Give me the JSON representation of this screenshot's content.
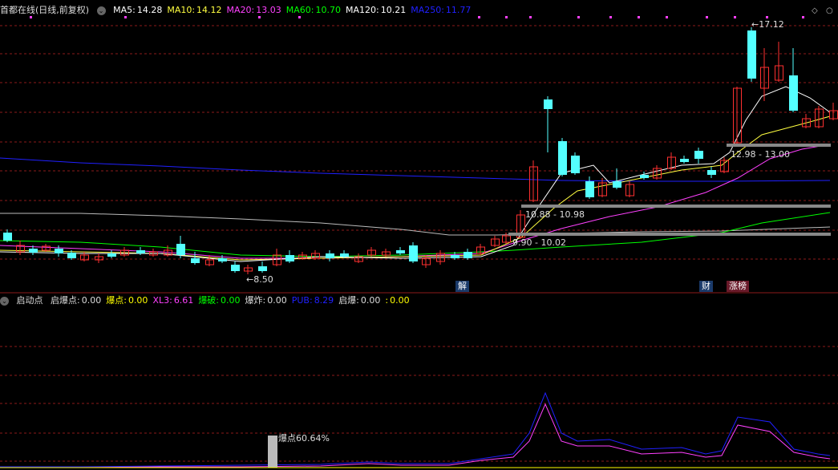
{
  "header": {
    "stock_name": "首都在线",
    "mode": "(日线,前复权)",
    "ma": [
      {
        "label": "MA5:",
        "value": "14.28",
        "color": "#ffffff"
      },
      {
        "label": "MA10:",
        "value": "14.12",
        "color": "#ffff40"
      },
      {
        "label": "MA20:",
        "value": "13.03",
        "color": "#ff40ff"
      },
      {
        "label": "MA60:",
        "value": "10.70",
        "color": "#00ff00"
      },
      {
        "label": "MA120:",
        "value": "10.21",
        "color": "#ffffff"
      },
      {
        "label": "MA250:",
        "value": "11.77",
        "color": "#2020ff"
      }
    ]
  },
  "price_annotations": {
    "high": "17.12",
    "low": "8.50",
    "zone1": "12.98 - 13.00",
    "zone2": "10.88 - 10.98",
    "zone3": "9.90 - 10.02"
  },
  "event_tags": {
    "jie": "解",
    "cai": "财",
    "zhangbang": "涨榜"
  },
  "indicator": {
    "name": "启动点",
    "items": [
      {
        "label": "启爆点:",
        "value": "0.00",
        "color": "#dddddd"
      },
      {
        "label": "爆点:",
        "value": "0.00",
        "color": "#ffff00"
      },
      {
        "label": "XL3:",
        "value": "6.61",
        "color": "#ff40ff"
      },
      {
        "label": "爆破:",
        "value": "0.00",
        "color": "#00ff00"
      },
      {
        "label": "爆炸:",
        "value": "0.00",
        "color": "#dddddd"
      },
      {
        "label": "PUB:",
        "value": "8.29",
        "color": "#2020ff"
      },
      {
        "label": "启爆:",
        "value": "0.00",
        "color": "#dddddd"
      },
      {
        "label": ":",
        "value": "0.00",
        "color": "#ffff00"
      }
    ],
    "bar_label": "爆点60.64%"
  },
  "colors": {
    "up": "#ff3030",
    "down": "#54ffff",
    "grid": "#8b1a1a",
    "bg": "#000000"
  },
  "icons": [
    "chevron-down-icon",
    "diamond-icon",
    "settings-icon"
  ]
}
